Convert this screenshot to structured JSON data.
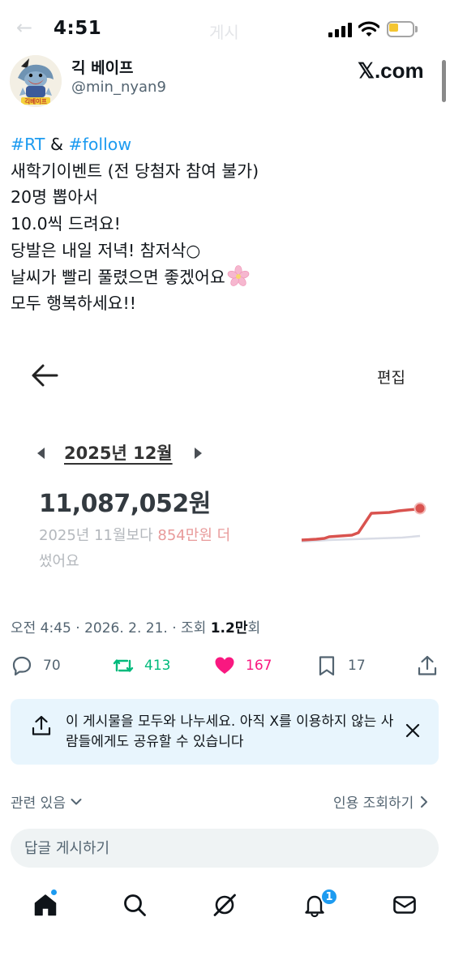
{
  "status_bar": {
    "time": "4:51",
    "ghost_back": "←",
    "ghost_title": "게시",
    "battery_color": "#f4c531"
  },
  "post": {
    "author_name": "긱 베이프",
    "author_handle": "@min_nyan9",
    "source_logo": "𝕏.com",
    "avatar_caption": "긱베이프",
    "text": {
      "hashtag_1": "#RT",
      "amp": " & ",
      "hashtag_2": "#follow",
      "lines": [
        "새학기이벤트 (전 당첨자 참여 불가)",
        "20명 뽑아서",
        "10.0씩 드려요!",
        "당발은 내일 저녁! 참저삭○",
        "날씨가 빨리 풀렸으면 좋겠어요",
        "모두 행복하세요!!"
      ],
      "emoji": "cherry-blossom-icon"
    },
    "timestamp": "오전 4:45 · 2026. 2. 21.",
    "views_prefix": " · 조회 ",
    "views_count": "1.2만",
    "views_suffix": "회"
  },
  "embedded_screenshot": {
    "edit_label": "편집",
    "month": "2025년 12월",
    "amount": "11,087,052원",
    "compare_prefix": "2025년 11월보다 ",
    "compare_diff": "854만원 더",
    "compare_suffix": " 썼어요",
    "current_line_color": "#d9534f",
    "previous_line_color": "#d9dce6"
  },
  "actions": {
    "replies": "70",
    "reposts": "413",
    "likes": "167",
    "bookmarks": "17"
  },
  "share_prompt": {
    "text": "이 게시물을 모두와 나누세요. 아직 X를 이용하지 않는 사람들에게도 공유할 수 있습니다"
  },
  "related": {
    "label": "관련 있음",
    "quotes_label": "인용 조회하기"
  },
  "reply": {
    "placeholder": "답글 게시하기"
  },
  "tabbar": {
    "notifications_badge": "1",
    "accent": "#1d9bf0"
  }
}
